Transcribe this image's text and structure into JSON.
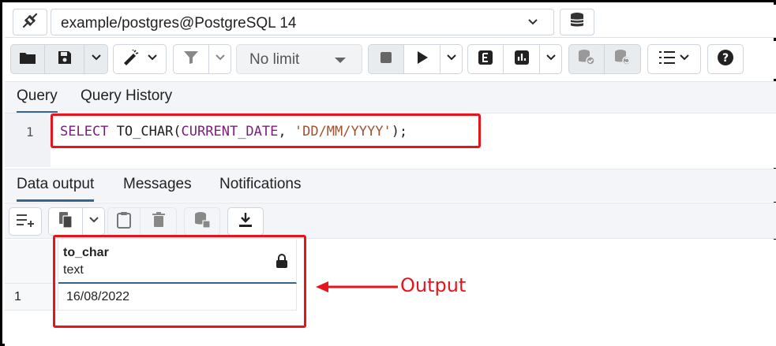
{
  "connection": {
    "label": "example/postgres@PostgreSQL 14",
    "icon": "connection-plug-icon"
  },
  "toolbar": {
    "limit_label": "No limit",
    "icons": [
      "folder-icon",
      "save-icon",
      "edit-icon",
      "filter-icon",
      "stop-icon",
      "play-icon",
      "explain-icon",
      "chart-icon",
      "commit-icon",
      "rollback-icon",
      "macros-icon",
      "help-icon"
    ]
  },
  "query_tabs": [
    {
      "label": "Query",
      "active": true
    },
    {
      "label": "Query History",
      "active": false
    }
  ],
  "editor": {
    "line_number": "1",
    "tokens": [
      {
        "text": "SELECT",
        "type": "keyword"
      },
      {
        "text": " TO_CHAR(",
        "type": "plain"
      },
      {
        "text": "CURRENT_DATE",
        "type": "keyword"
      },
      {
        "text": ", ",
        "type": "plain"
      },
      {
        "text": "'DD/MM/YYYY'",
        "type": "string"
      },
      {
        "text": ");",
        "type": "plain"
      }
    ]
  },
  "output_tabs": [
    {
      "label": "Data output",
      "active": true
    },
    {
      "label": "Messages",
      "active": false
    },
    {
      "label": "Notifications",
      "active": false
    }
  ],
  "grid": {
    "column": {
      "name": "to_char",
      "type": "text"
    },
    "rows": [
      {
        "num": "1",
        "value": "16/08/2022"
      }
    ]
  },
  "annotation": {
    "label": "Output",
    "color": "#e8141c"
  },
  "colors": {
    "accent": "#326690",
    "keyword": "#7a1e7a",
    "string": "#a0522d"
  }
}
